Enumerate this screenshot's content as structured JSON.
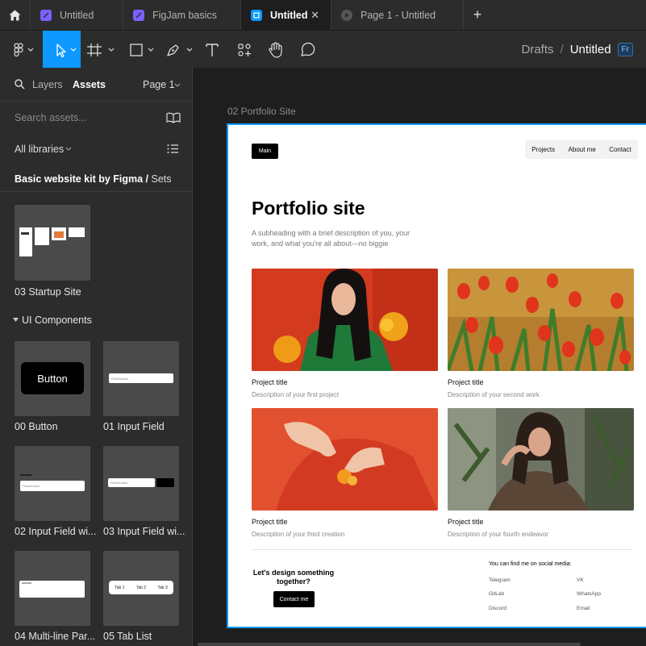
{
  "tabs": [
    {
      "label": "Untitled",
      "icon": "figjam-file-icon"
    },
    {
      "label": "FigJam basics",
      "icon": "figjam-file-icon"
    },
    {
      "label": "Untitled",
      "icon": "design-file-icon"
    },
    {
      "label": "Page 1 - Untitled",
      "icon": "play-icon"
    }
  ],
  "tab_close": "✕",
  "new_tab": "+",
  "breadcrumb": {
    "drafts": "Drafts",
    "sep": "/",
    "file": "Untitled",
    "badge": "Fr"
  },
  "panel": {
    "tab_layers": "Layers",
    "tab_assets": "Assets",
    "page": "Page 1",
    "search_placeholder": "Search assets...",
    "libraries": "All libraries",
    "kit": "Basic website kit by Figma /",
    "sets": "Sets",
    "startup": "03 Startup Site",
    "section": "UI Components",
    "components": [
      {
        "label": "00 Button",
        "preview_text": "Button"
      },
      {
        "label": "01 Input Field",
        "preview_text": "Placeholder"
      },
      {
        "label": "02 Input Field wi...",
        "preview_text": "Placeholder"
      },
      {
        "label": "03 Input Field wi...",
        "preview_text": "Placeholder"
      },
      {
        "label": "04 Multi-line Par...",
        "preview_text": ""
      },
      {
        "label": "05 Tab List",
        "tabs": [
          "Tab 1",
          "Tab 2",
          "Tab 3"
        ]
      }
    ]
  },
  "frame": {
    "label": "02 Portfolio Site",
    "main_button": "Main",
    "nav": [
      "Projects",
      "About me",
      "Contact"
    ],
    "title": "Portfolio site",
    "subheading": "A subheading with a brief description of you, your work, and what you're all about—no biggie",
    "projects": [
      {
        "title": "Project title",
        "desc": "Description of your first project"
      },
      {
        "title": "Project title",
        "desc": "Description of your second work"
      },
      {
        "title": "Project title",
        "desc": "Description of your third creation"
      },
      {
        "title": "Project title",
        "desc": "Description of your fourth endeavor"
      }
    ],
    "cta": "Let's design something together?",
    "contact_button": "Contact me",
    "social_heading": "You can find me on social media:",
    "social": [
      "Telegram",
      "VK",
      "GitLab",
      "WhatsApp",
      "Discord",
      "Email"
    ]
  },
  "colors": {
    "accent": "#0d99ff",
    "panel": "#2c2c2c",
    "canvas": "#1e1e1e"
  }
}
